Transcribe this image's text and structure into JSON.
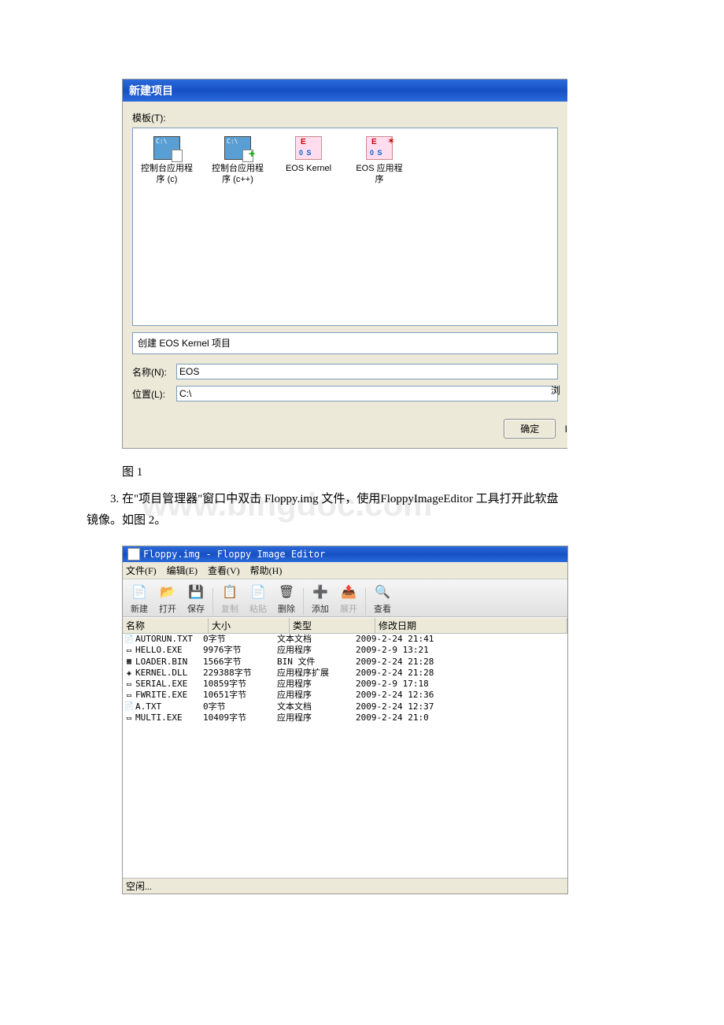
{
  "dialog1": {
    "title": "新建项目",
    "templates_label": "模板(T):",
    "templates": [
      {
        "label": "控制台应用程序 (c)"
      },
      {
        "label": "控制台应用程序 (c++)"
      },
      {
        "label": "EOS Kernel"
      },
      {
        "label": "EOS 应用程序"
      }
    ],
    "description": "创建 EOS Kernel 项目",
    "name_label": "名称(N):",
    "name_value": "EOS",
    "location_label": "位置(L):",
    "location_value": "C:\\",
    "browse_label": "浏",
    "ok_label": "确定",
    "cancel_stub": "I"
  },
  "caption1": "图 1",
  "paragraph": "3. 在\"项目管理器\"窗口中双击 Floppy.img 文件，使用FloppyImageEditor 工具打开此软盘镜像。如图 2。",
  "watermark": "www.bingdoc.com",
  "editor": {
    "title": "Floppy.img - Floppy Image Editor",
    "menu": [
      "文件(F)",
      "编辑(E)",
      "查看(V)",
      "帮助(H)"
    ],
    "toolbar": [
      {
        "label": "新建",
        "icon": "📄",
        "enabled": true
      },
      {
        "label": "打开",
        "icon": "📂",
        "enabled": true
      },
      {
        "label": "保存",
        "icon": "💾",
        "enabled": true
      },
      {
        "label": "复制",
        "icon": "📋",
        "enabled": false
      },
      {
        "label": "粘贴",
        "icon": "📄",
        "enabled": false
      },
      {
        "label": "删除",
        "icon": "🗑",
        "enabled": true
      },
      {
        "label": "添加",
        "icon": "➕",
        "enabled": true
      },
      {
        "label": "展开",
        "icon": "📤",
        "enabled": false
      },
      {
        "label": "查看",
        "icon": "🔍",
        "enabled": true
      }
    ],
    "columns": {
      "name": "名称",
      "size": "大小",
      "type": "类型",
      "date": "修改日期"
    },
    "files": [
      {
        "icon": "📄",
        "name": "AUTORUN.TXT",
        "size": "0字节",
        "type": "文本文档",
        "date": "2009-2-24 21:41"
      },
      {
        "icon": "▭",
        "name": "HELLO.EXE",
        "size": "9976字节",
        "type": "应用程序",
        "date": "2009-2-9 13:21"
      },
      {
        "icon": "▦",
        "name": "LOADER.BIN",
        "size": "1566字节",
        "type": "BIN 文件",
        "date": "2009-2-24 21:28"
      },
      {
        "icon": "◈",
        "name": "KERNEL.DLL",
        "size": "229388字节",
        "type": "应用程序扩展",
        "date": "2009-2-24 21:28"
      },
      {
        "icon": "▭",
        "name": "SERIAL.EXE",
        "size": "10859字节",
        "type": "应用程序",
        "date": "2009-2-9 17:18"
      },
      {
        "icon": "▭",
        "name": "FWRITE.EXE",
        "size": "10651字节",
        "type": "应用程序",
        "date": "2009-2-24 12:36"
      },
      {
        "icon": "📄",
        "name": "A.TXT",
        "size": "0字节",
        "type": "文本文档",
        "date": "2009-2-24 12:37"
      },
      {
        "icon": "▭",
        "name": "MULTI.EXE",
        "size": "10409字节",
        "type": "应用程序",
        "date": "2009-2-24 21:0"
      }
    ],
    "status": "空闲..."
  }
}
